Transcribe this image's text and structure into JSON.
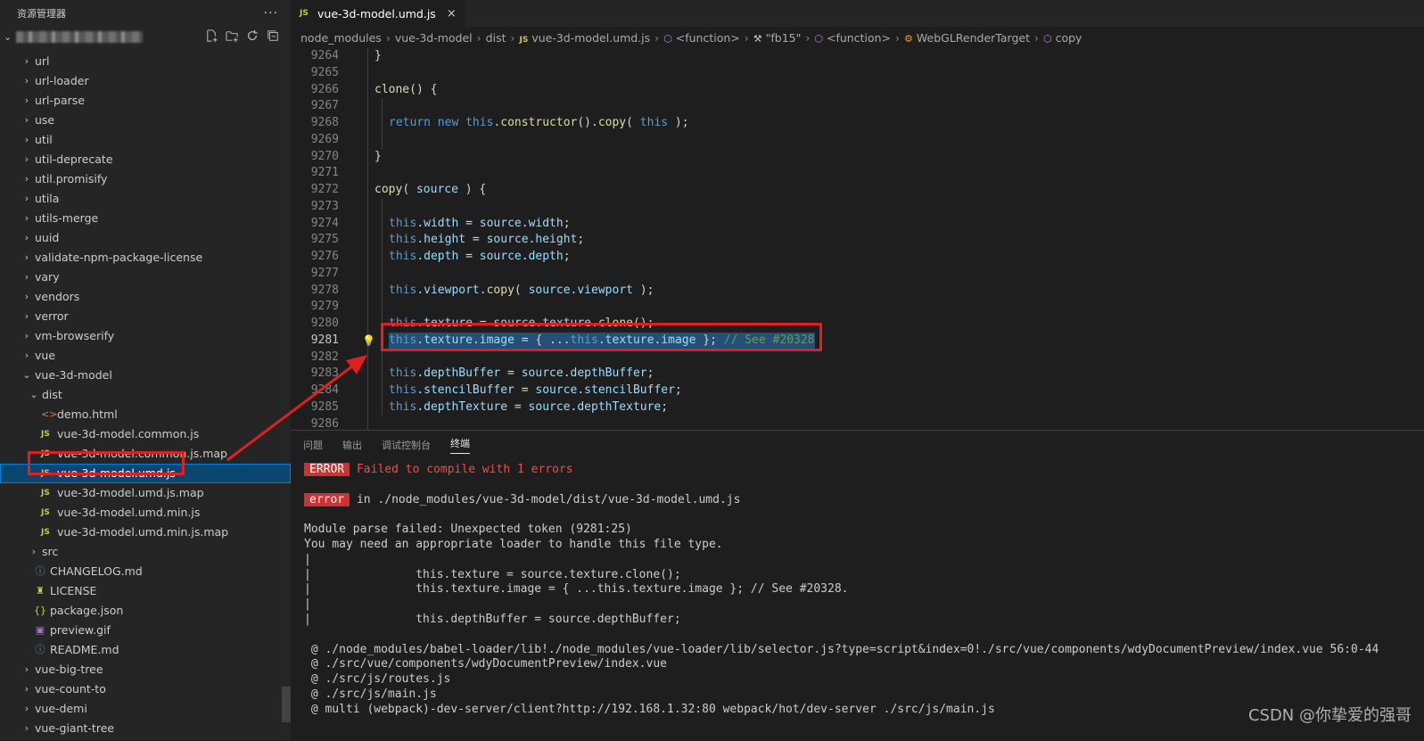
{
  "sidebar": {
    "title": "资源管理器",
    "more": "···",
    "tree": [
      {
        "label": "url",
        "indent": 0,
        "type": "folder",
        "open": false
      },
      {
        "label": "url-loader",
        "indent": 0,
        "type": "folder",
        "open": false
      },
      {
        "label": "url-parse",
        "indent": 0,
        "type": "folder",
        "open": false
      },
      {
        "label": "use",
        "indent": 0,
        "type": "folder",
        "open": false
      },
      {
        "label": "util",
        "indent": 0,
        "type": "folder",
        "open": false
      },
      {
        "label": "util-deprecate",
        "indent": 0,
        "type": "folder",
        "open": false
      },
      {
        "label": "util.promisify",
        "indent": 0,
        "type": "folder",
        "open": false
      },
      {
        "label": "utila",
        "indent": 0,
        "type": "folder",
        "open": false
      },
      {
        "label": "utils-merge",
        "indent": 0,
        "type": "folder",
        "open": false
      },
      {
        "label": "uuid",
        "indent": 0,
        "type": "folder",
        "open": false
      },
      {
        "label": "validate-npm-package-license",
        "indent": 0,
        "type": "folder",
        "open": false
      },
      {
        "label": "vary",
        "indent": 0,
        "type": "folder",
        "open": false
      },
      {
        "label": "vendors",
        "indent": 0,
        "type": "folder",
        "open": false
      },
      {
        "label": "verror",
        "indent": 0,
        "type": "folder",
        "open": false
      },
      {
        "label": "vm-browserify",
        "indent": 0,
        "type": "folder",
        "open": false
      },
      {
        "label": "vue",
        "indent": 0,
        "type": "folder",
        "open": false
      },
      {
        "label": "vue-3d-model",
        "indent": 0,
        "type": "folder",
        "open": true
      },
      {
        "label": "dist",
        "indent": 1,
        "type": "folder",
        "open": true
      },
      {
        "label": "demo.html",
        "indent": 2,
        "type": "html"
      },
      {
        "label": "vue-3d-model.common.js",
        "indent": 2,
        "type": "js"
      },
      {
        "label": "vue-3d-model.common.js.map",
        "indent": 2,
        "type": "js"
      },
      {
        "label": "vue-3d-model.umd.js",
        "indent": 2,
        "type": "js",
        "selected": true
      },
      {
        "label": "vue-3d-model.umd.js.map",
        "indent": 2,
        "type": "js"
      },
      {
        "label": "vue-3d-model.umd.min.js",
        "indent": 2,
        "type": "js"
      },
      {
        "label": "vue-3d-model.umd.min.js.map",
        "indent": 2,
        "type": "js"
      },
      {
        "label": "src",
        "indent": 1,
        "type": "folder",
        "open": false
      },
      {
        "label": "CHANGELOG.md",
        "indent": 1,
        "type": "md"
      },
      {
        "label": "LICENSE",
        "indent": 1,
        "type": "license"
      },
      {
        "label": "package.json",
        "indent": 1,
        "type": "json"
      },
      {
        "label": "preview.gif",
        "indent": 1,
        "type": "gif"
      },
      {
        "label": "README.md",
        "indent": 1,
        "type": "info"
      },
      {
        "label": "vue-big-tree",
        "indent": 0,
        "type": "folder",
        "open": false
      },
      {
        "label": "vue-count-to",
        "indent": 0,
        "type": "folder",
        "open": false
      },
      {
        "label": "vue-demi",
        "indent": 0,
        "type": "folder",
        "open": false
      },
      {
        "label": "vue-giant-tree",
        "indent": 0,
        "type": "folder",
        "open": false
      }
    ]
  },
  "editor": {
    "tab": {
      "icon": "JS",
      "label": "vue-3d-model.umd.js",
      "close": "×"
    },
    "breadcrumb": [
      "node_modules",
      "vue-3d-model",
      "dist",
      "vue-3d-model.umd.js",
      "<function>",
      "\"fb15\"",
      "<function>",
      "WebGLRenderTarget",
      "copy"
    ],
    "lines": [
      {
        "n": "9264",
        "t": "}",
        "i": 0
      },
      {
        "n": "9265",
        "t": "",
        "i": 0
      },
      {
        "n": "9266",
        "t": "clone() {",
        "i": 0
      },
      {
        "n": "9267",
        "t": "",
        "i": 0
      },
      {
        "n": "9268",
        "t": "return new this.constructor().copy( this );",
        "i": 1
      },
      {
        "n": "9269",
        "t": "",
        "i": 0
      },
      {
        "n": "9270",
        "t": "}",
        "i": 0
      },
      {
        "n": "9271",
        "t": "",
        "i": 0
      },
      {
        "n": "9272",
        "t": "copy( source ) {",
        "i": 0
      },
      {
        "n": "9273",
        "t": "",
        "i": 0
      },
      {
        "n": "9274",
        "t": "this.width = source.width;",
        "i": 1
      },
      {
        "n": "9275",
        "t": "this.height = source.height;",
        "i": 1
      },
      {
        "n": "9276",
        "t": "this.depth = source.depth;",
        "i": 1
      },
      {
        "n": "9277",
        "t": "",
        "i": 0
      },
      {
        "n": "9278",
        "t": "this.viewport.copy( source.viewport );",
        "i": 1
      },
      {
        "n": "9279",
        "t": "",
        "i": 0
      },
      {
        "n": "9280",
        "t": "this.texture = source.texture.clone();",
        "i": 1
      },
      {
        "n": "9281",
        "t": "this.texture.image = { ...this.texture.image }; // See #20328",
        "i": 1,
        "current": true
      },
      {
        "n": "9282",
        "t": "",
        "i": 0
      },
      {
        "n": "9283",
        "t": "this.depthBuffer = source.depthBuffer;",
        "i": 1
      },
      {
        "n": "9284",
        "t": "this.stencilBuffer = source.stencilBuffer;",
        "i": 1
      },
      {
        "n": "9285",
        "t": "this.depthTexture = source.depthTexture;",
        "i": 1
      },
      {
        "n": "9286",
        "t": "",
        "i": 0
      }
    ]
  },
  "panel": {
    "tabs": [
      "问题",
      "输出",
      "调试控制台",
      "终端"
    ],
    "active_tab": 3,
    "error_badge": "ERROR",
    "error_msg": "Failed to compile with 1 errors",
    "error_badge2": "error",
    "error_in": "in ./node_modules/vue-3d-model/dist/vue-3d-model.umd.js",
    "lines": [
      "Module parse failed: Unexpected token (9281:25)",
      "You may need an appropriate loader to handle this file type.",
      "|",
      "|               this.texture = source.texture.clone();",
      "|               this.texture.image = { ...this.texture.image }; // See #20328.",
      "|",
      "|               this.depthBuffer = source.depthBuffer;",
      "",
      " @ ./node_modules/babel-loader/lib!./node_modules/vue-loader/lib/selector.js?type=script&index=0!./src/vue/components/wdyDocumentPreview/index.vue 56:0-44",
      " @ ./src/vue/components/wdyDocumentPreview/index.vue",
      " @ ./src/js/routes.js",
      " @ ./src/js/main.js",
      " @ multi (webpack)-dev-server/client?http://192.168.1.32:80 webpack/hot/dev-server ./src/js/main.js"
    ]
  },
  "watermark": "CSDN @你挚爱的强哥",
  "colors": {
    "accent": "#007fd4",
    "error": "#cd3131",
    "annotation": "#e02020",
    "selection": "#264f78"
  }
}
